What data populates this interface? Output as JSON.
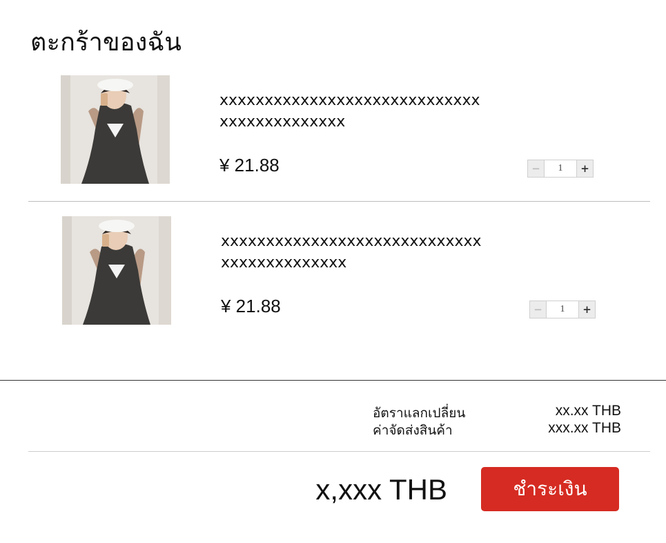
{
  "page_title": "ตะกร้าของฉัน",
  "items": [
    {
      "name": "xxxxxxxxxxxxxxxxxxxxxxxxxxxxxxxxxxxxxxxxxxx",
      "price": "¥ 21.88",
      "quantity": "1",
      "minus": "−",
      "plus": "+",
      "image_icon": "product-photo-dress"
    },
    {
      "name": "xxxxxxxxxxxxxxxxxxxxxxxxxxxxxxxxxxxxxxxxxxx",
      "price": "¥ 21.88",
      "quantity": "1",
      "minus": "−",
      "plus": "+",
      "image_icon": "product-photo-dress"
    }
  ],
  "summary": {
    "rows": [
      {
        "label": "อัตราแลกเปลี่ยน",
        "value": "xx.xx THB"
      },
      {
        "label": "ค่าจัดส่งสินค้า",
        "value": "xxx.xx THB"
      }
    ]
  },
  "total": "x,xxx THB",
  "checkout_label": "ชำระเงิน",
  "colors": {
    "accent": "#d52b22",
    "divider": "#bdbdbd"
  }
}
